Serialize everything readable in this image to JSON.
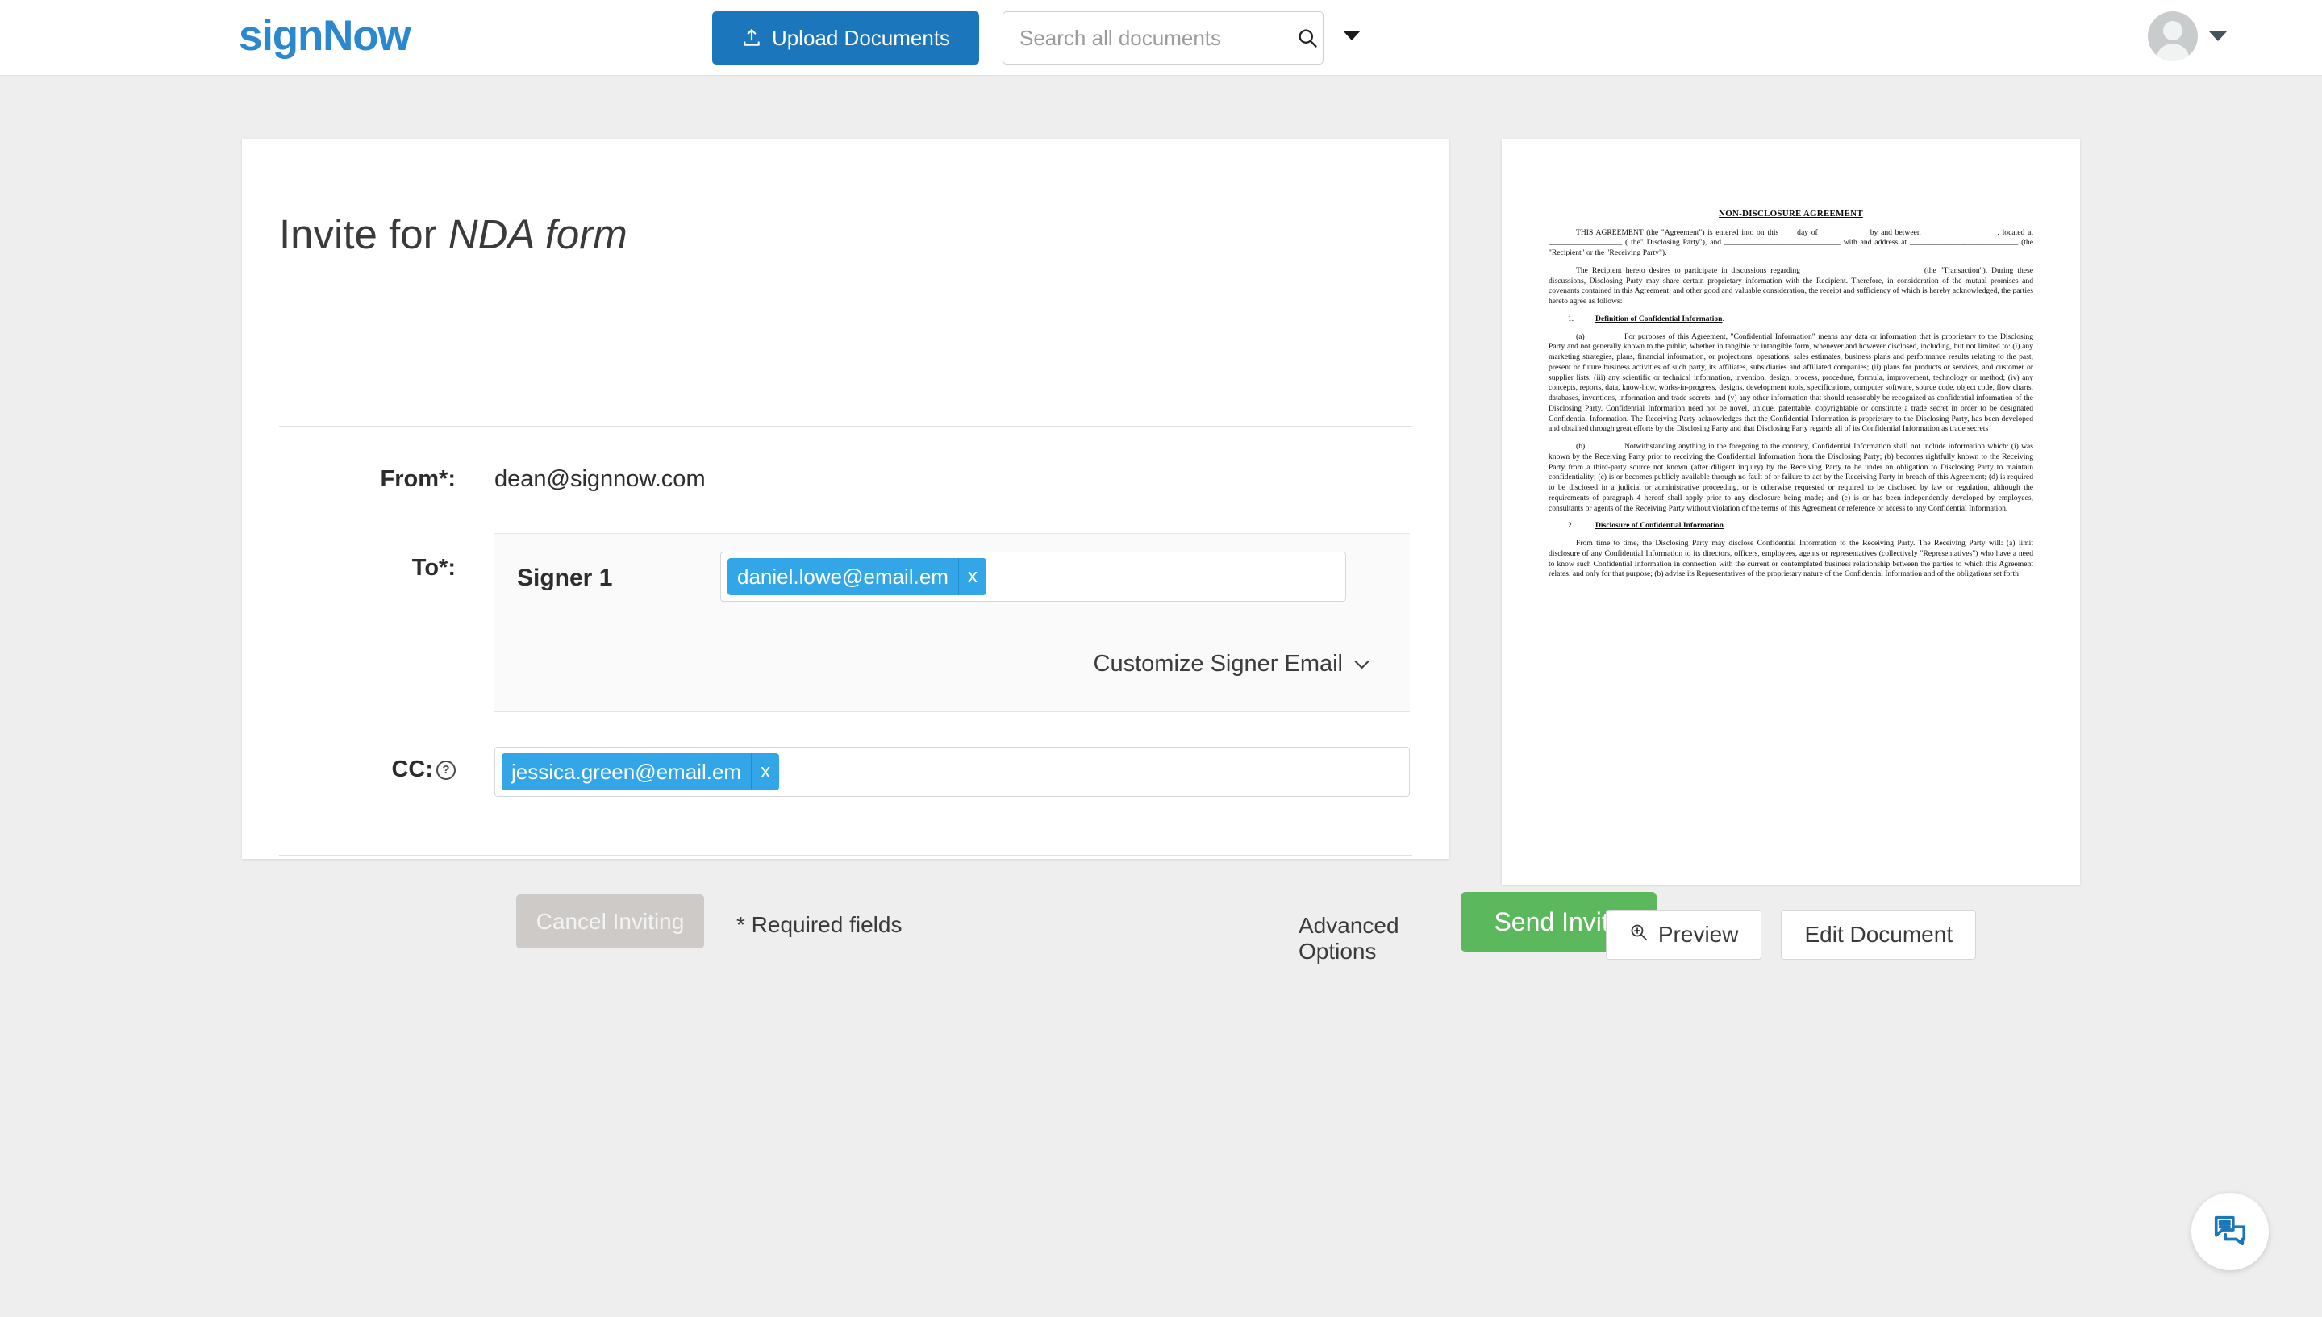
{
  "topbar": {
    "logo_sign": "sign",
    "logo_now": "Now",
    "upload_label": "Upload Documents",
    "upload_icon": "upload-icon",
    "search_placeholder": "Search all documents",
    "search_value": "",
    "search_icon": "search-icon",
    "search_caret_icon": "caret-down-icon",
    "avatar_icon": "user-avatar-icon",
    "avatar_caret_icon": "caret-down-icon",
    "accent_blue": "#1b76bc",
    "logo_blue": "#2a87d0"
  },
  "invite": {
    "title_prefix": "Invite for ",
    "title_document": "NDA form",
    "from_label": "From*:",
    "from_value": "dean@signnow.com",
    "to_label": "To*:",
    "signer_label": "Signer 1",
    "signer_email": "daniel.lowe@email.em",
    "signer_remove_icon": "x",
    "customize_label": "Customize Signer Email",
    "customize_chevron_icon": "chevron-down-icon",
    "cc_label": "CC:",
    "cc_help_icon": "?",
    "cc_email": "jessica.green@email.em",
    "cc_remove_icon": "x",
    "cancel_label": "Cancel Inviting",
    "required_note": "* Required fields",
    "advanced_options_label": "Advanced Options",
    "send_label": "Send Invite",
    "tag_blue": "#33a6e8",
    "send_green": "#5cb85c",
    "cancel_gray": "#cecac7"
  },
  "document": {
    "title": "NON-DISCLOSURE AGREEMENT",
    "paragraphs": [
      "THIS AGREEMENT (the \"Agreement\") is entered into on this ____day of ____________ by and between ___________________, located at ___________________ ( the\" Disclosing Party\"), and ______________________________ with and address at ____________________________ (the \"Recipient\" or the \"Receiving Party\").",
      "The Recipient hereto desires to participate in discussions regarding ______________________________ (the \"Transaction\"). During these discussions, Disclosing Party may share certain proprietary information with the Recipient. Therefore, in consideration of the mutual promises and covenants contained in this Agreement, and other good and valuable consideration, the receipt and sufficiency of which is hereby acknowledged, the parties hereto agree as follows:"
    ],
    "section1_num": "1.",
    "section1_head": "Definition of Confidential Information",
    "section1_a_mark": "(a)",
    "section1_a_text": "For purposes of this Agreement, \"Confidential Information\" means any data or information that is proprietary to the Disclosing Party and not generally known to the public, whether in tangible or intangible form, whenever and however disclosed, including, but not limited to: (i) any marketing strategies, plans, financial information, or projections, operations, sales estimates, business plans and performance results relating to the past, present or future business activities of such party, its affiliates, subsidiaries and affiliated companies; (ii) plans for products or services, and customer or supplier lists; (iii) any scientific or technical information, invention, design, process, procedure, formula, improvement, technology or method; (iv) any concepts, reports, data, know-how, works-in-progress, designs, development tools, specifications, computer software, source code, object code, flow charts, databases, inventions, information and trade secrets; and (v) any other information that should reasonably be recognized as confidential information of the Disclosing Party. Confidential Information need not be novel, unique, patentable, copyrightable or constitute a trade secret in order to be designated Confidential Information. The Receiving Party acknowledges that the Confidential Information is proprietary to the Disclosing Party, has been developed and obtained through great efforts by the Disclosing Party and that Disclosing Party regards all of its Confidential Information as trade secrets",
    "section1_b_mark": "(b)",
    "section1_b_text": "Notwithstanding anything in the foregoing to the contrary, Confidential Information shall not include information which: (i) was known by the Receiving Party prior to receiving the Confidential Information from the Disclosing Party; (b) becomes rightfully known to the Receiving Party from a third-party source not known (after diligent inquiry) by the Receiving Party to be under an obligation to Disclosing Party to maintain confidentiality; (c) is or becomes publicly available through no fault of or failure to act by the Receiving Party in breach of this Agreement; (d) is required to be disclosed in a judicial or administrative proceeding, or is otherwise requested or required to be disclosed by law or regulation, although the requirements of paragraph 4 hereof shall apply prior to any disclosure being made; and (e) is or has been independently developed by employees, consultants or agents of the Receiving Party without violation of the terms of this Agreement or reference or access to any Confidential Information.",
    "section2_num": "2.",
    "section2_head": "Disclosure of Confidential Information",
    "section2_text": "From time to time, the Disclosing Party may disclose Confidential Information to the Receiving Party. The Receiving Party will: (a) limit disclosure of any Confidential Information to its directors, officers, employees, agents or representatives (collectively \"Representatives\") who have a need to know such Confidential Information in connection with the current or contemplated business relationship between the parties to which this Agreement relates, and only for that purpose; (b) advise its Representatives of the proprietary nature of the Confidential Information and of the obligations set forth"
  },
  "doc_actions": {
    "preview_label": "Preview",
    "preview_icon": "zoom-in-icon",
    "edit_label": "Edit Document"
  },
  "chat": {
    "icon": "chat-bubble-icon",
    "color": "#1b76bc"
  }
}
